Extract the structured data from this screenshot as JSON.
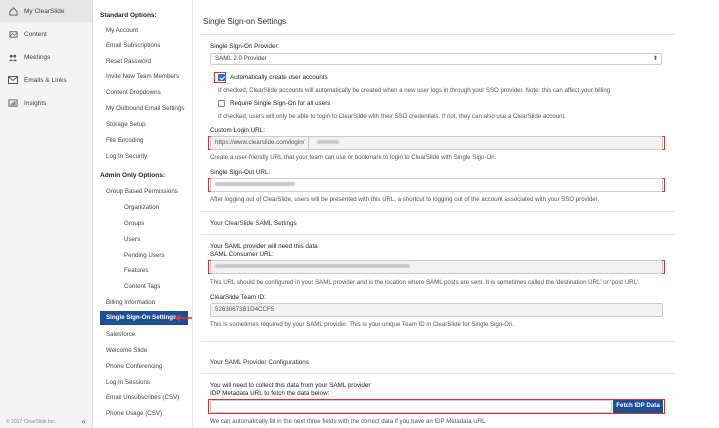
{
  "app_nav": {
    "items": [
      {
        "label": "My ClearSlide",
        "icon": "home-icon"
      },
      {
        "label": "Content",
        "icon": "content-icon"
      },
      {
        "label": "Meetings",
        "icon": "meetings-icon"
      },
      {
        "label": "Emails & Links",
        "icon": "email-icon"
      },
      {
        "label": "Insights",
        "icon": "insights-icon"
      }
    ],
    "footer": "© 2017 ClearSlide Inc.",
    "collapse": "«"
  },
  "settings_sidebar": {
    "standard_heading": "Standard Options:",
    "standard_items": [
      "My Account",
      "Email Subscriptions",
      "Reset Password",
      "Invite New Team Members",
      "Content Dropdowns",
      "My Outbound Email Settings",
      "Storage Setup",
      "File Encoding",
      "Log In Security"
    ],
    "admin_heading": "Admin Only Options:",
    "group_perms": "Group Based Permissions",
    "group_sub": [
      "Organization",
      "Groups",
      "Users",
      "Pending Users",
      "Features",
      "Content Tags"
    ],
    "admin_items": [
      "Billing Information",
      "Single Sign-On Settings",
      "Salesforce",
      "Welcome Slide",
      "Phone Conferencing",
      "Log In Sessions",
      "Email Unsubscribes (CSV)",
      "Phone Usage (CSV)"
    ],
    "active": "Single Sign-On Settings"
  },
  "main": {
    "title": "Single Sign-on Settings",
    "provider_label": "Single Sign-On Provider:",
    "provider_value": "SAML 2.0 Provider",
    "auto_create_label": "Automatically create user accounts",
    "auto_create_checked": true,
    "auto_create_help": "If checked, ClearSlide accounts will automatically be created when a new user logs in through your SSO provider. Note: this can affect your billing",
    "require_sso_label": "Require Single Sign-On for all users",
    "require_sso_checked": false,
    "require_sso_help": "If checked, users will only be able to login to ClearSlide with their SSO credentials. If not, they can also use a ClearSlide account.",
    "custom_login_label": "Custom Login URL:",
    "custom_login_prefix": "https://www.clearslide.com/login/",
    "custom_login_help": "Create a user-friendly URL that your team can use or bookmark to login to ClearSlide with Single Sign-On.",
    "signout_label": "Single Sign-Out URL:",
    "signout_help": "After logging out of ClearSlide, users will be presented with this URL, a shortcut to logging out of the account associated with your SSO provider.",
    "saml_section": "Your ClearSlide SAML Settings",
    "saml_need": "Your SAML provider will need this data",
    "consumer_label": "SAML Consumer URL:",
    "consumer_help": "This URL should be configured in your SAML provider and is the location where SAML posts are sent. It is sometimes called the 'destination URL' or 'post URL'.",
    "team_id_label": "ClearSlide Team ID:",
    "team_id_value": "52630673B1D4CCF5",
    "team_id_help": "This is sometimes required by your SAML provider. This is your unique Team ID in ClearSlide for Single Sign-On.",
    "provider_config_section": "Your SAML Provider Configurations",
    "collect_text": "You will need to collect this data from your SAML provider",
    "idp_label": "IDP Metadata URL to fetch the data below:",
    "fetch_button": "Fetch IDP Data",
    "idp_help": "We can automatically fill in the next three fields with the correct data if you have an IDP Metadata URL"
  },
  "colors": {
    "accent": "#1e4f95",
    "highlight": "#d9342b",
    "checkbox": "#2c6fd1"
  }
}
